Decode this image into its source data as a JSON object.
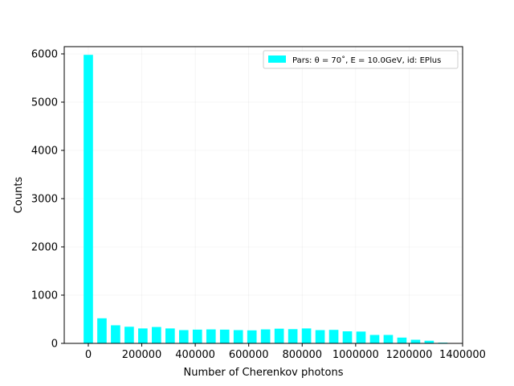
{
  "chart_data": {
    "type": "bar",
    "xlabel": "Number of Cherenkov photons",
    "ylabel": "Counts",
    "xlim": [
      -90000,
      1400000
    ],
    "ylim": [
      0,
      6150
    ],
    "xticks": [
      0,
      200000,
      400000,
      600000,
      800000,
      1000000,
      1200000,
      1400000
    ],
    "xtick_labels": [
      "0",
      "200000",
      "400000",
      "600000",
      "800000",
      "1000000",
      "1200000",
      "1400000"
    ],
    "yticks": [
      0,
      1000,
      2000,
      3000,
      4000,
      5000,
      6000
    ],
    "ytick_labels": [
      "0",
      "1000",
      "2000",
      "3000",
      "4000",
      "5000",
      "6000"
    ],
    "grid": true,
    "legend_position": "upper-right",
    "bar_color": "#00ffff",
    "bar_width_data": 35000,
    "series": [
      {
        "name": "Pars: θ = 70˚, E = 10.0GeV, id: EPlus",
        "x": [
          0,
          51000,
          102000,
          153000,
          204000,
          255000,
          306000,
          357000,
          408000,
          459000,
          510000,
          561000,
          612000,
          663000,
          714000,
          765000,
          816000,
          867000,
          918000,
          969000,
          1020000,
          1071000,
          1122000,
          1173000,
          1224000,
          1275000,
          1326000
        ],
        "values": [
          5980,
          520,
          375,
          345,
          310,
          340,
          310,
          275,
          285,
          290,
          285,
          275,
          270,
          290,
          305,
          295,
          310,
          275,
          280,
          250,
          245,
          175,
          175,
          120,
          75,
          55,
          15
        ]
      }
    ]
  }
}
